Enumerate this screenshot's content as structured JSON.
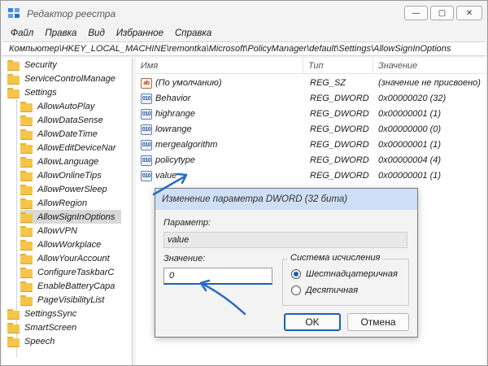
{
  "window": {
    "title": "Редактор реестра",
    "min_label": "—",
    "max_label": "▢",
    "close_label": "✕"
  },
  "menu": [
    "Файл",
    "Правка",
    "Вид",
    "Избранное",
    "Справка"
  ],
  "address": "Компьютер\\HKEY_LOCAL_MACHINE\\remontka\\Microsoft\\PolicyManager\\default\\Settings\\AllowSignInOptions",
  "tree": [
    "Security",
    "ServiceControlManage",
    "Settings",
    "AllowAutoPlay",
    "AllowDataSense",
    "AllowDateTime",
    "AllowEditDeviceNar",
    "AllowLanguage",
    "AllowOnlineTips",
    "AllowPowerSleep",
    "AllowRegion",
    "AllowSignInOptions",
    "AllowVPN",
    "AllowWorkplace",
    "AllowYourAccount",
    "ConfigureTaskbarC",
    "EnableBatteryCapa",
    "PageVisibilityList",
    "SettingsSync",
    "SmartScreen",
    "Speech"
  ],
  "list": {
    "headers": {
      "name": "Имя",
      "type": "Тип",
      "value": "Значение"
    },
    "rows": [
      {
        "icon": "ab",
        "name": "(По умолчанию)",
        "type": "REG_SZ",
        "value": "(значение не присвоено)"
      },
      {
        "icon": "010",
        "name": "Behavior",
        "type": "REG_DWORD",
        "value": "0x00000020 (32)"
      },
      {
        "icon": "010",
        "name": "highrange",
        "type": "REG_DWORD",
        "value": "0x00000001 (1)"
      },
      {
        "icon": "010",
        "name": "lowrange",
        "type": "REG_DWORD",
        "value": "0x00000000 (0)"
      },
      {
        "icon": "010",
        "name": "mergealgorithm",
        "type": "REG_DWORD",
        "value": "0x00000001 (1)"
      },
      {
        "icon": "010",
        "name": "policytype",
        "type": "REG_DWORD",
        "value": "0x00000004 (4)"
      },
      {
        "icon": "010",
        "name": "value",
        "type": "REG_DWORD",
        "value": "0x00000001 (1)"
      }
    ]
  },
  "dialog": {
    "title": "Изменение параметра DWORD (32 бита)",
    "param_label": "Параметр:",
    "param_value": "value",
    "value_label": "Значение:",
    "value": "0",
    "base_label": "Система исчисления",
    "hex_label": "Шестнадцатеричная",
    "dec_label": "Десятичная",
    "ok": "OK",
    "cancel": "Отмена"
  },
  "colors": {
    "accent": "#1f5fb4",
    "dialog_title_bg": "#cfe0f6",
    "arrow": "#2a6cc0"
  }
}
